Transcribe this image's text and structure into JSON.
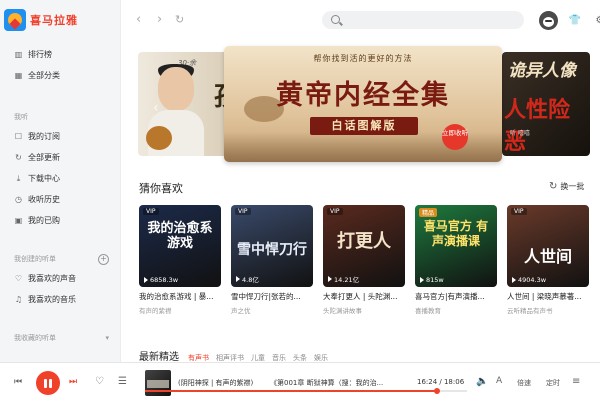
{
  "app": {
    "name": "喜马拉雅",
    "accent": "#f0412b"
  },
  "sidebar": {
    "top_items": [
      {
        "icon": "chart-icon",
        "label": "排行榜"
      },
      {
        "icon": "grid-icon",
        "label": "全部分类"
      }
    ],
    "my_header": "我听",
    "my_items": [
      {
        "icon": "bookmark-icon",
        "label": "我的订阅"
      },
      {
        "icon": "refresh-icon",
        "label": "全部更新"
      },
      {
        "icon": "download-icon",
        "label": "下载中心"
      },
      {
        "icon": "history-icon",
        "label": "收听历史"
      },
      {
        "icon": "bag-icon",
        "label": "我的已购"
      }
    ],
    "created_header": "我创建的听单",
    "created_items": [
      {
        "icon": "heart-icon",
        "label": "我喜欢的声音"
      },
      {
        "icon": "music-icon",
        "label": "我喜欢的音乐"
      }
    ],
    "collected_header": "我收藏的听单"
  },
  "topbar": {
    "search_placeholder": ""
  },
  "banner": {
    "left": {
      "subtitle": "30·余",
      "big_char": "孩"
    },
    "main": {
      "kicker": "帮你找到活的更好的方法",
      "title": "黄帝内经全集",
      "ribbon": "白话图解版",
      "badge": "立即收听"
    },
    "right": {
      "line1": "诡异人像",
      "line2": "人性险恶",
      "line3": "听 嘻嘻"
    }
  },
  "section": {
    "title": "猜你喜欢",
    "refresh_label": "换一批"
  },
  "cards": [
    {
      "tag": "VIP",
      "cover_text": "我的治愈系游戏",
      "plays": "6858.3w",
      "title": "我的治愈系游戏 | 暴...",
      "author": "有声的紫襟",
      "bg": "#1c2a4a",
      "fg": "#ffffff"
    },
    {
      "tag": "VIP",
      "cover_text": "雪中悍刀行",
      "plays": "4.8亿",
      "title": "雪中悍刀行|张若的...",
      "author": "声之优",
      "bg": "#3a4a6a",
      "fg": "#e8eef8"
    },
    {
      "tag": "VIP",
      "cover_text": "打更人",
      "plays": "14.21亿",
      "title": "大奉打更人 | 头陀渊...",
      "author": "头陀渊讲故事",
      "bg": "#5a2a1e",
      "fg": "#f3e3c8"
    },
    {
      "tag": "精品",
      "cover_text": "喜马官方 有声演播课",
      "plays": "815w",
      "title": "喜马官方|有声演播...",
      "author": "喜播教育",
      "bg": "#1e7a3e",
      "fg": "#ffe36a"
    },
    {
      "tag": "VIP",
      "cover_text": "人世间",
      "plays": "4904.3w",
      "title": "人世间 | 梁晓声慕著...",
      "author": "云听精品有声书",
      "bg": "#6a3a2a",
      "fg": "#ffffff"
    }
  ],
  "latest": {
    "title": "最新精选",
    "tabs": [
      "有声书",
      "相声评书",
      "儿童",
      "音乐",
      "头条",
      "娱乐"
    ],
    "active": 0
  },
  "player": {
    "now_title": "(阴阳神探 | 有声的紫襟)",
    "chapter": "《第001章 断狱神算（搜：我的治...",
    "time": "16:24 / 18:06",
    "progress": 0.906,
    "speed_label": "倍速",
    "timer_label": "定时"
  }
}
